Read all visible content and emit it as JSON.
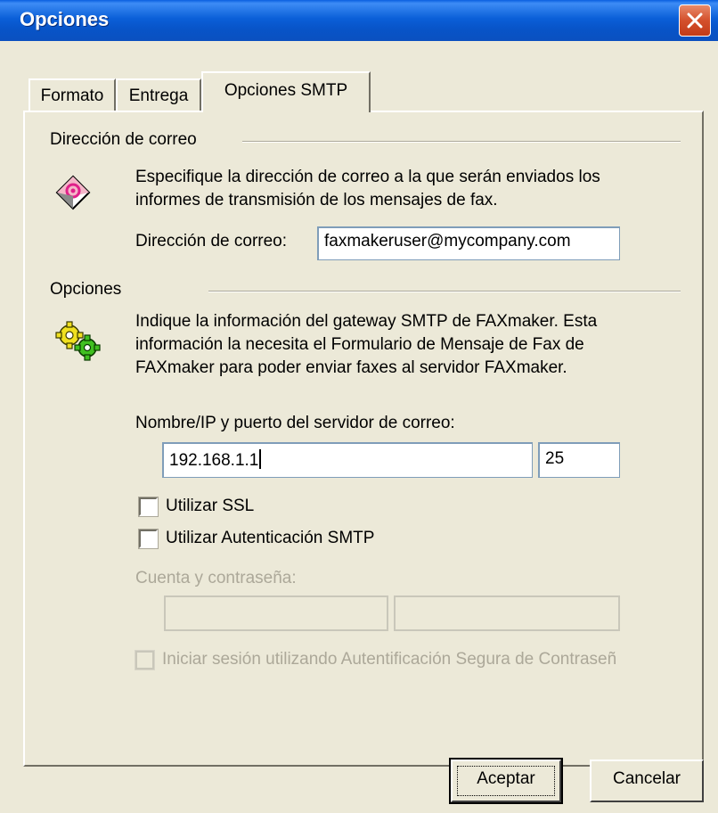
{
  "window": {
    "title": "Opciones"
  },
  "tabs": [
    {
      "label": "Formato"
    },
    {
      "label": "Entrega"
    },
    {
      "label": "Opciones SMTP"
    }
  ],
  "email_section": {
    "heading": "Dirección de correo",
    "description_line1": "Especifique la dirección de correo a la que serán enviados los",
    "description_line2": "informes de transmisión de los mensajes de fax.",
    "field_label": "Dirección de correo:",
    "field_value": "faxmakeruser@mycompany.com",
    "icon": "email-address-icon"
  },
  "options_section": {
    "heading": "Opciones",
    "description_line1": "Indique la información del gateway SMTP de FAXmaker.  Esta",
    "description_line2": "información la necesita el Formulario de Mensaje de Fax de",
    "description_line3": "FAXmaker para poder enviar faxes al servidor FAXmaker.",
    "server_label": "Nombre/IP y puerto del servidor de correo:",
    "server_value": "192.168.1.1",
    "port_value": "25",
    "ssl_label": "Utilizar SSL",
    "ssl_checked": false,
    "smtp_auth_label": "Utilizar Autenticación SMTP",
    "smtp_auth_checked": false,
    "account_label": "Cuenta y contraseña:",
    "account_value": "",
    "password_value": "",
    "spa_label": "Iniciar sesión utilizando Autentificación Segura de Contraseñ",
    "spa_checked": false,
    "icon": "gears-icon"
  },
  "buttons": {
    "ok_label": "Aceptar",
    "cancel_label": "Cancelar"
  },
  "colors": {
    "title_bar": "#0a5fd8",
    "dialog_bg": "#ece9d8",
    "disabled_text": "#aca899",
    "close_button": "#d4502c"
  }
}
